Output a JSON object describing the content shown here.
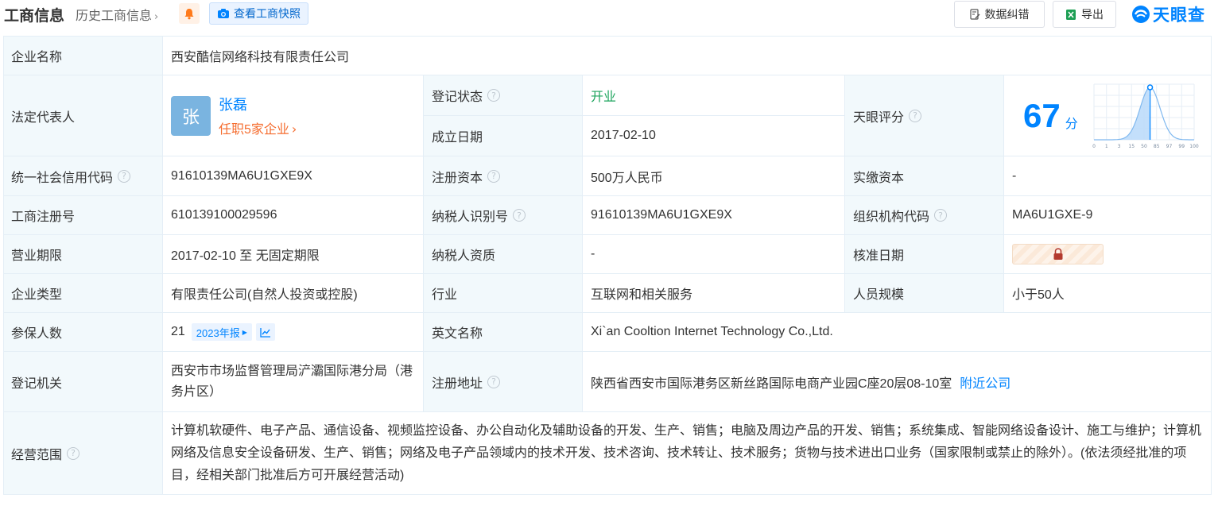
{
  "header": {
    "title": "工商信息",
    "history_link": "历史工商信息",
    "snapshot_button": "查看工商快照",
    "correct_button": "数据纠错",
    "export_button": "导出",
    "logo_text": "天眼查"
  },
  "labels": {
    "company_name": "企业名称",
    "legal_rep": "法定代表人",
    "reg_status": "登记状态",
    "found_date": "成立日期",
    "tianyan_score": "天眼评分",
    "credit_code": "统一社会信用代码",
    "reg_capital": "注册资本",
    "paid_capital": "实缴资本",
    "reg_number": "工商注册号",
    "taxpayer_id": "纳税人识别号",
    "org_code": "组织机构代码",
    "business_term": "营业期限",
    "taxpayer_qual": "纳税人资质",
    "approval_date": "核准日期",
    "company_type": "企业类型",
    "industry": "行业",
    "staff_size": "人员规模",
    "insured_count": "参保人数",
    "english_name": "英文名称",
    "reg_authority": "登记机关",
    "reg_address": "注册地址",
    "business_scope": "经营范围"
  },
  "values": {
    "company_name": "西安酷信网络科技有限责任公司",
    "legal_rep_avatar": "张",
    "legal_rep_name": "张磊",
    "legal_rep_jobs": "任职5家企业",
    "reg_status": "开业",
    "found_date": "2017-02-10",
    "score": "67",
    "score_unit": "分",
    "credit_code": "91610139MA6U1GXE9X",
    "reg_capital": "500万人民币",
    "paid_capital": "-",
    "reg_number": "610139100029596",
    "taxpayer_id": "91610139MA6U1GXE9X",
    "org_code": "MA6U1GXE-9",
    "business_term": "2017-02-10 至 无固定期限",
    "taxpayer_qual": "-",
    "company_type": "有限责任公司(自然人投资或控股)",
    "industry": "互联网和相关服务",
    "staff_size": "小于50人",
    "insured_count": "21",
    "report_year": "2023年报",
    "english_name": "Xi`an Cooltion Internet Technology Co.,Ltd.",
    "reg_authority": "西安市市场监督管理局浐灞国际港分局（港务片区）",
    "reg_address": "陕西省西安市国际港务区新丝路国际电商产业园C座20层08-10室",
    "nearby_link": "附近公司",
    "business_scope": "计算机软硬件、电子产品、通信设备、视频监控设备、办公自动化及辅助设备的开发、生产、销售；电脑及周边产品的开发、销售；系统集成、智能网络设备设计、施工与维护；计算机网络及信息安全设备研发、生产、销售；网络及电子产品领域内的技术开发、技术咨询、技术转让、技术服务；货物与技术进出口业务（国家限制或禁止的除外）。(依法须经批准的项目，经相关部门批准后方可开展经营活动)"
  },
  "score_chart": {
    "x_ticks": [
      "0",
      "1",
      "3",
      "15",
      "50",
      "85",
      "97",
      "99",
      "100"
    ],
    "marker_value": 67
  },
  "colors": {
    "accent": "#0084ff",
    "label_bg": "#f2f9fc",
    "status_green": "#1ea45d",
    "jobs_orange": "#f56c2e"
  }
}
